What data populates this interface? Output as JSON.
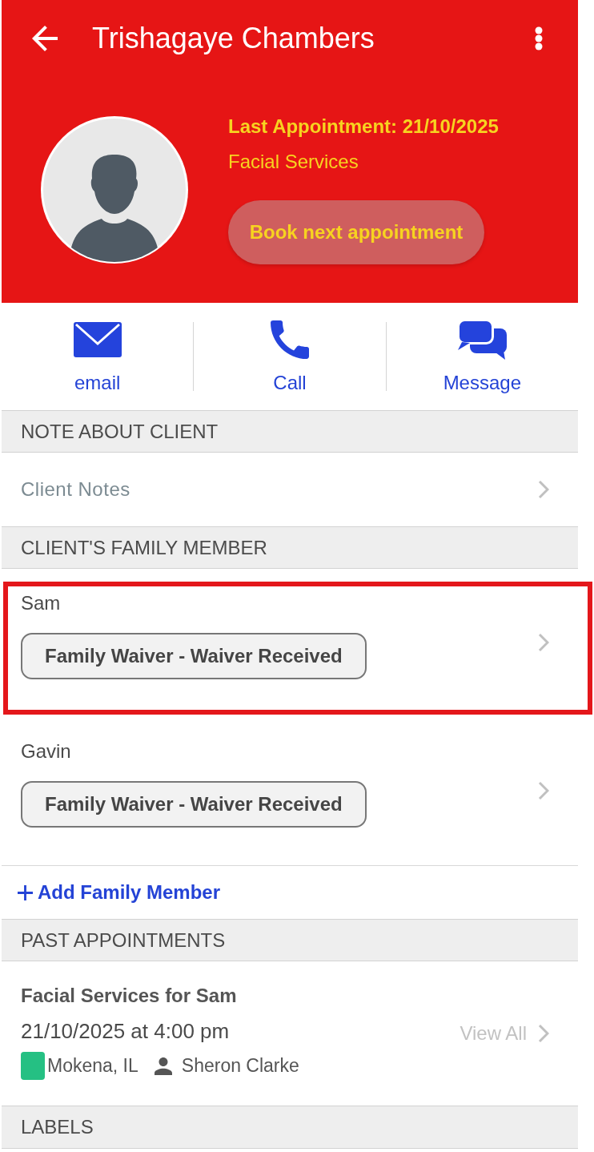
{
  "app_bar": {
    "title": "Trishagaye Chambers"
  },
  "profile": {
    "last_appointment": "Last Appointment: 21/10/2025",
    "service": "Facial Services",
    "book_button": "Book next appointment"
  },
  "contact_actions": [
    {
      "kind": "email",
      "label": "email"
    },
    {
      "kind": "call",
      "label": "Call"
    },
    {
      "kind": "message",
      "label": "Message"
    }
  ],
  "note_section": {
    "heading": "NOTE ABOUT CLIENT",
    "item": "Client Notes"
  },
  "family_section": {
    "heading": "CLIENT'S FAMILY MEMBER",
    "members": [
      {
        "name": "Sam",
        "waiver": "Family Waiver - Waiver Received",
        "highlighted": true
      },
      {
        "name": "Gavin",
        "waiver": "Family Waiver - Waiver Received",
        "highlighted": false
      }
    ],
    "add_link": "Add Family Member"
  },
  "past_appointments": {
    "heading": "PAST APPOINTMENTS",
    "items": [
      {
        "title": "Facial Services for Sam",
        "datetime": "21/10/2025 at 4:00 pm",
        "location": "Mokena, IL",
        "color": "#25c083",
        "staff": "Sheron Clarke"
      }
    ],
    "view_all": "View All"
  },
  "labels_section": {
    "heading": "LABELS"
  }
}
